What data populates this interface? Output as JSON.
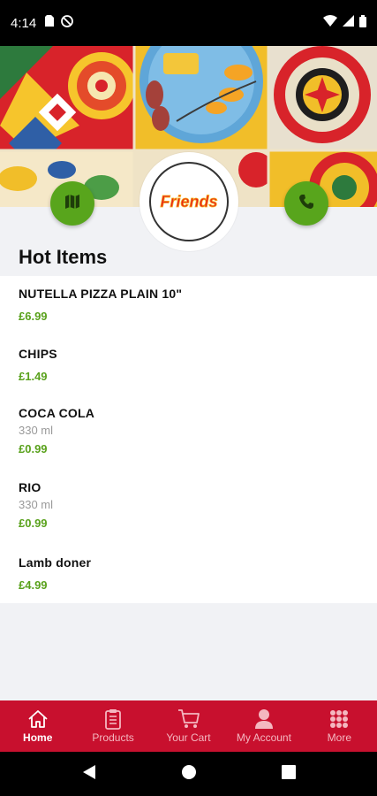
{
  "status_bar": {
    "time": "4:14"
  },
  "header": {
    "logo_text": "Friends",
    "map_icon": "map-icon",
    "phone_icon": "phone-icon"
  },
  "section_title": "Hot Items",
  "items": [
    {
      "name": "NUTELLA PIZZA PLAIN 10\"",
      "desc": "",
      "price": "£6.99"
    },
    {
      "name": "CHIPS",
      "desc": "",
      "price": "£1.49"
    },
    {
      "name": "COCA COLA",
      "desc": "330 ml",
      "price": "£0.99"
    },
    {
      "name": "RIO",
      "desc": "330 ml",
      "price": "£0.99"
    },
    {
      "name": "Lamb doner",
      "desc": "",
      "price": "£4.99"
    }
  ],
  "bottom_nav": [
    {
      "label": "Home",
      "icon": "home-icon",
      "active": true
    },
    {
      "label": "Products",
      "icon": "menu-card-icon",
      "active": false
    },
    {
      "label": "Your Cart",
      "icon": "cart-icon",
      "active": false
    },
    {
      "label": "My Account",
      "icon": "account-icon",
      "active": false
    },
    {
      "label": "More",
      "icon": "grid-icon",
      "active": false
    }
  ],
  "colors": {
    "accent_red": "#c8102e",
    "price_green": "#5aa21d",
    "button_green": "#58a51c"
  }
}
